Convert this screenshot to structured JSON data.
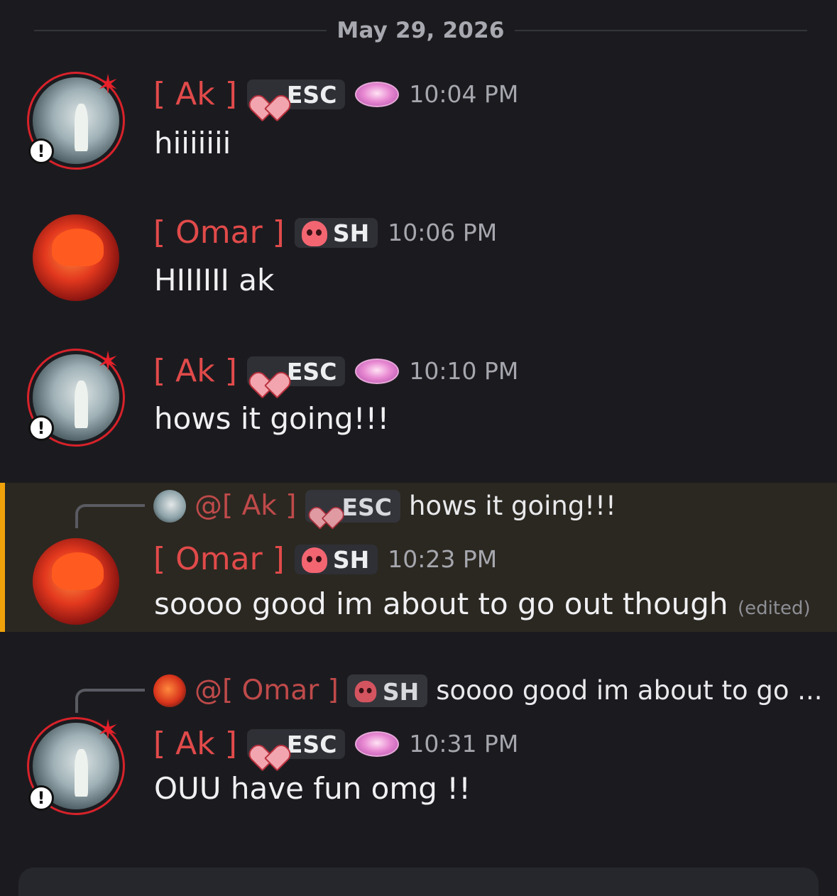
{
  "date_divider": "May 29, 2026",
  "messages": [
    {
      "author": "[ Ak ]",
      "role_tag": "ESC",
      "time": "10:04 PM",
      "text": "hiiiiiii"
    },
    {
      "author": "[ Omar ]",
      "role_tag": "SH",
      "time": "10:06 PM",
      "text": "HIIIIII ak"
    },
    {
      "author": "[ Ak ]",
      "role_tag": "ESC",
      "time": "10:10 PM",
      "text": "hows it going!!!"
    },
    {
      "reply": {
        "mention": "@[ Ak ]",
        "role_tag": "ESC",
        "text": "hows it going!!!"
      },
      "author": "[ Omar ]",
      "role_tag": "SH",
      "time": "10:23 PM",
      "text": "soooo good im about to go out though",
      "edited": "(edited)"
    },
    {
      "reply": {
        "mention": "@[ Omar ]",
        "role_tag": "SH",
        "text": "soooo good im about to go ..."
      },
      "author": "[ Ak ]",
      "role_tag": "ESC",
      "time": "10:31 PM",
      "text": "OUU have fun omg !!"
    }
  ],
  "colors": {
    "background": "#1b1b1f",
    "username": "#e14a4a",
    "highlight_bar": "#f0a20b",
    "highlight_bg": "#2b2821"
  },
  "icons": {
    "esc_role": "heart-icon",
    "sh_role": "skull-icon",
    "profile_badge": "fiovivor-badge-icon",
    "avatar_decoration": "anger-mark-icon",
    "avatar_status": "alert-icon"
  }
}
